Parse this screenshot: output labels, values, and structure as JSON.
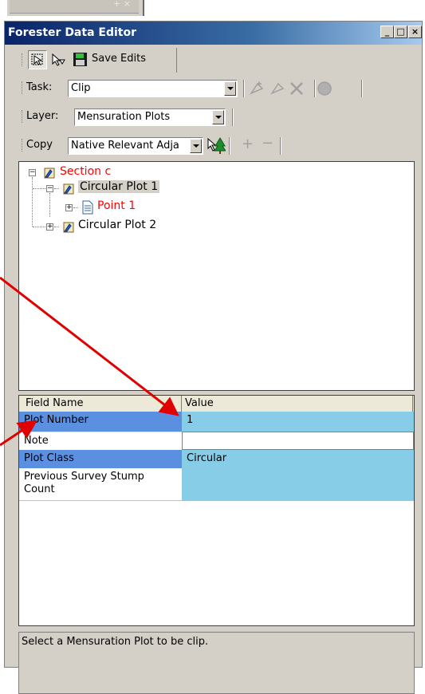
{
  "window": {
    "title": "Forester Data Editor"
  },
  "toolbar1": {
    "save_label": "Save Edits"
  },
  "task": {
    "label": "Task:",
    "value": "Clip"
  },
  "layer": {
    "label": "Layer:",
    "value": "Mensuration Plots"
  },
  "copy": {
    "label": "Copy",
    "value": "Native Relevant Adja"
  },
  "tree": {
    "nodes": [
      {
        "label": "Section c",
        "color": "#ff0000"
      },
      {
        "label": "Circular Plot 1",
        "color": "#000000"
      },
      {
        "label": "Point 1",
        "color": "#ff0000"
      },
      {
        "label": "Circular Plot 2",
        "color": "#000000"
      }
    ]
  },
  "grid": {
    "headers": [
      "Field Name",
      "Value"
    ],
    "rows": [
      {
        "field": "Plot Number",
        "value": "1"
      },
      {
        "field": "Note",
        "value": ""
      },
      {
        "field": "Plot Class",
        "value": "Circular"
      },
      {
        "field": "Previous Survey Stump Count",
        "value": ""
      }
    ]
  },
  "status": {
    "text": "Select a Mensuration Plot to be clip."
  },
  "colors": {
    "selected_field": "#5b8fe0",
    "value_cell": "#87cde8",
    "annotation_arrow": "#e00000"
  }
}
